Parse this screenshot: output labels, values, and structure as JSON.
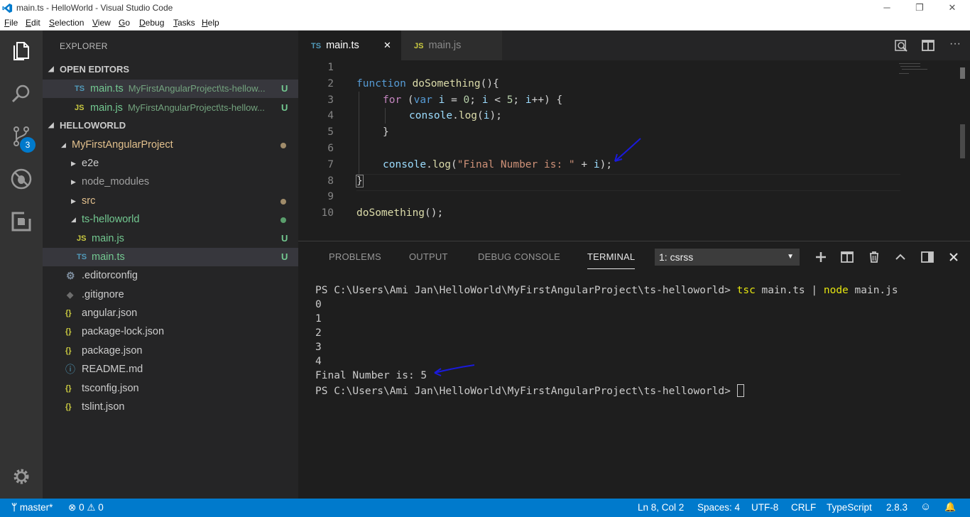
{
  "window": {
    "title": "main.ts - HelloWorld - Visual Studio Code",
    "minimize": "─",
    "maximize": "❐",
    "close": "✕"
  },
  "menu": [
    {
      "u": "F",
      "rest": "ile"
    },
    {
      "u": "E",
      "rest": "dit"
    },
    {
      "u": "S",
      "rest": "election"
    },
    {
      "u": "V",
      "rest": "iew"
    },
    {
      "u": "G",
      "rest": "o"
    },
    {
      "u": "D",
      "rest": "ebug"
    },
    {
      "u": "T",
      "rest": "asks"
    },
    {
      "u": "H",
      "rest": "elp"
    }
  ],
  "activity": {
    "scm_badge": "3"
  },
  "sidebar": {
    "title": "EXPLORER",
    "open_editors_label": "OPEN EDITORS",
    "open_editors": [
      {
        "icon": "TS",
        "name": "main.ts",
        "path": "MyFirstAngularProject\\ts-hellow...",
        "status": "U"
      },
      {
        "icon": "JS",
        "name": "main.js",
        "path": "MyFirstAngularProject\\ts-hellow...",
        "status": "U"
      }
    ],
    "workspace_label": "HELLOWORLD",
    "tree": {
      "project": "MyFirstAngularProject",
      "e2e": "e2e",
      "node_modules": "node_modules",
      "src": "src",
      "ts_helloworld": "ts-helloworld",
      "main_js": "main.js",
      "main_js_icon": "JS",
      "main_js_status": "U",
      "main_ts": "main.ts",
      "main_ts_icon": "TS",
      "main_ts_status": "U",
      "editorconfig": ".editorconfig",
      "gitignore": ".gitignore",
      "angular_json": "angular.json",
      "package_lock": "package-lock.json",
      "package_json": "package.json",
      "readme": "README.md",
      "tsconfig": "tsconfig.json",
      "tslint": "tslint.json",
      "braces_icon": "{}",
      "info_icon": "ⓘ"
    }
  },
  "tabs": [
    {
      "icon": "TS",
      "label": "main.ts",
      "close": "✕"
    },
    {
      "icon": "JS",
      "label": "main.js"
    }
  ],
  "editor": {
    "line_numbers": [
      "1",
      "2",
      "3",
      "4",
      "5",
      "6",
      "7",
      "8",
      "9",
      "10"
    ],
    "code": {
      "l2_kw": "function",
      "l2_fn": "doSomething",
      "l2_rest": "(){",
      "l3_for": "for",
      "l3_a": " (",
      "l3_var": "var",
      "l3_i": "i",
      "l3_eq": " = ",
      "l3_0": "0",
      "l3_semi": "; ",
      "l3_i2": "i",
      "l3_lt": " < ",
      "l3_5": "5",
      "l3_semi2": "; ",
      "l3_i3": "i",
      "l3_end": "++) {",
      "l4_console": "console",
      "l4_dot": ".",
      "l4_log": "log",
      "l4_open": "(",
      "l4_i": "i",
      "l4_close": ");",
      "l5": "}",
      "l7_console": "console",
      "l7_dot": ".",
      "l7_log": "log",
      "l7_open": "(",
      "l7_str": "\"Final Number is: \"",
      "l7_plus": " + ",
      "l7_i": "i",
      "l7_close": ");",
      "l8": "}",
      "l10_fn": "doSomething",
      "l10_rest": "();"
    }
  },
  "panel": {
    "tabs": [
      "PROBLEMS",
      "OUTPUT",
      "DEBUG CONSOLE",
      "TERMINAL"
    ],
    "terminal_select": "1: csrss",
    "terminal": {
      "prompt": "PS C:\\Users\\Ami Jan\\HelloWorld\\MyFirstAngularProject\\ts-helloworld> ",
      "cmd1": "tsc",
      "arg1": " main.ts | ",
      "cmd2": "node",
      "arg2": " main.js",
      "out": [
        "0",
        "1",
        "2",
        "3",
        "4"
      ],
      "final": "Final Number is: 5",
      "prompt2": "PS C:\\Users\\Ami Jan\\HelloWorld\\MyFirstAngularProject\\ts-helloworld> "
    }
  },
  "status": {
    "branch": "master*",
    "errors": "0",
    "warnings": "0",
    "position": "Ln 8, Col 2",
    "spaces": "Spaces: 4",
    "encoding": "UTF-8",
    "eol": "CRLF",
    "language": "TypeScript",
    "version": "2.8.3"
  },
  "colors": {
    "accent": "#007acc",
    "untracked": "#73c991",
    "modified": "#e2c08d"
  }
}
